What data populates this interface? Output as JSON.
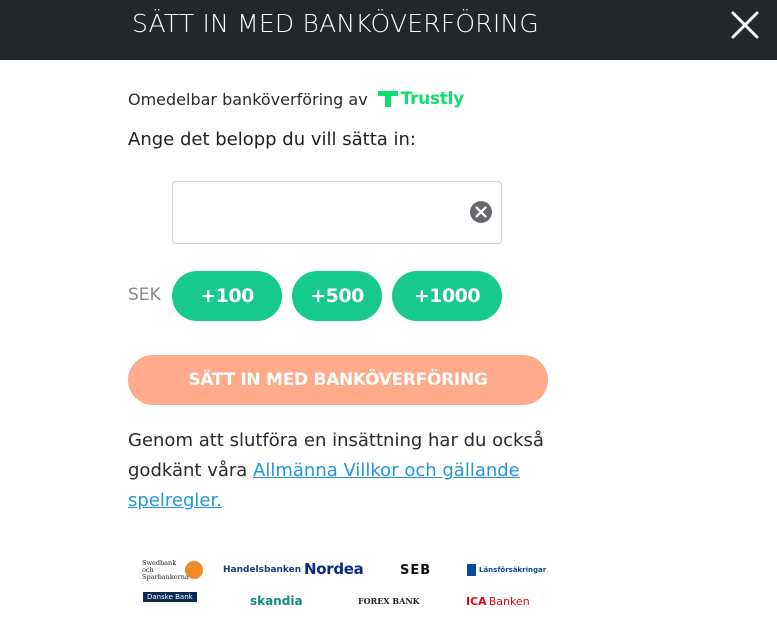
{
  "header": {
    "title": "SÄTT IN MED BANKÖVERFÖRING"
  },
  "provider": {
    "text": "Omedelbar banköverföring av",
    "brand": "Trustly",
    "brand_color": "#0ee06e"
  },
  "form": {
    "prompt": "Ange det belopp du vill sätta in:",
    "amount_value": "",
    "currency": "SEK",
    "quick_amounts": [
      "+100",
      "+500",
      "+1000"
    ],
    "quick_color": "#17c98f",
    "submit_label": "SÄTT IN MED BANKÖVERFÖRING",
    "submit_color": "#ffaa8b"
  },
  "terms": {
    "text_before": "Genom att slutföra en insättning har du också godkänt våra ",
    "link_text": "Allmänna Villkor och gällande spelregler.",
    "link_color": "#2196d9"
  },
  "banks": {
    "swedbank": "Swedbank och Sparbankerna",
    "handelsbanken": "Handelsbanken",
    "nordea": "Nordea",
    "seb": "SEB",
    "lansforsakringar": "Länsförsäkringar",
    "danske": "Danske Bank",
    "skandia": "skandia",
    "forex": "FOREX BANK",
    "ica": "ICA",
    "ica_sub": "Banken"
  },
  "icons": {
    "close": "close-icon",
    "clear": "clear-input-icon",
    "trustly": "trustly-logo-icon"
  }
}
